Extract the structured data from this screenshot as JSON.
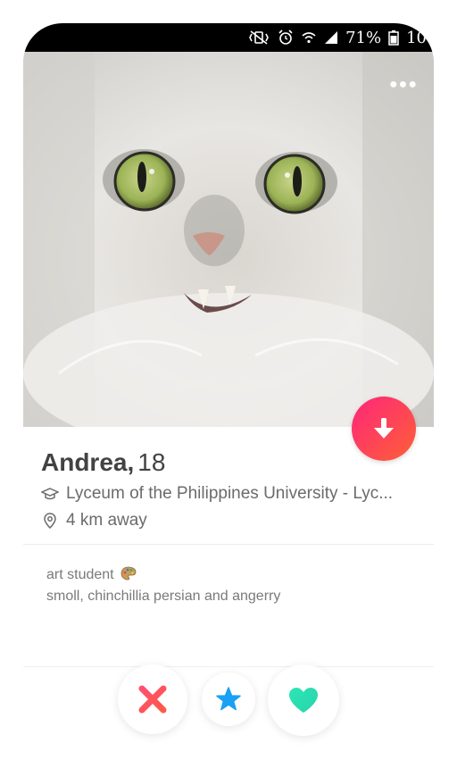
{
  "status_bar": {
    "battery_percent": "71%",
    "time": "10",
    "icons": [
      "mute-vibrate-icon",
      "alarm-icon",
      "wifi-icon",
      "signal-icon",
      "battery-icon"
    ]
  },
  "profile": {
    "name": "Andrea,",
    "age": "18",
    "school": "Lyceum of the Philippines University - Lyc...",
    "distance": "4 km away",
    "bio_line1": "art student",
    "bio_line2": "smoll, chinchillia persian and angerry",
    "bio_emoji": "artist-palette-icon"
  },
  "actions": {
    "nope_icon": "close-icon",
    "super_like_icon": "star-icon",
    "like_icon": "heart-icon"
  },
  "colors": {
    "info_button_start": "#fd267a",
    "info_button_end": "#ff6036",
    "nope": "#fd4b61",
    "super_like": "#1aa1f5",
    "like": "#2ee6b8"
  }
}
